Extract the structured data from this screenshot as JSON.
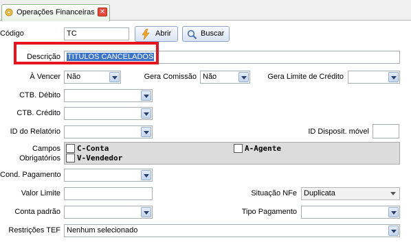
{
  "tab": {
    "label": "Operações Financeiras",
    "close_glyph": "✕",
    "icon": "gear-icon"
  },
  "toolbar": {
    "codigo_label": "Código",
    "codigo_value": "TC",
    "abrir_label": "Abrir",
    "buscar_label": "Buscar"
  },
  "form": {
    "descricao_label": "Descrição",
    "descricao_value": "TITULOS CANCELADOS",
    "a_vencer_label": "À Vencer",
    "a_vencer_value": "Não",
    "gera_comissao_label": "Gera Comissão",
    "gera_comissao_value": "Não",
    "gera_limite_label": "Gera Limite de Crédito",
    "gera_limite_value": "",
    "ctb_debito_label": "CTB. Débito",
    "ctb_credito_label": "CTB. Crédito",
    "id_relatorio_label": "ID do Relatório",
    "id_disposit_label": "ID Disposit. móvel",
    "campos_label_1": "Campos",
    "campos_label_2": "Obrigatórios",
    "checkboxes": {
      "c_conta": "C-Conta",
      "a_agente": "A-Agente",
      "v_vendedor": "V-Vendedor"
    },
    "cond_pagamento_label": "Cond. Pagamento",
    "valor_limite_label": "Valor Limite",
    "situacao_nfe_label": "Situação NFe",
    "situacao_nfe_value": "Duplicata",
    "conta_padrao_label": "Conta padrão",
    "tipo_pagamento_label": "Tipo Pagamento",
    "restricoes_tef_label": "Restrições TEF",
    "restricoes_tef_value": "Nenhum selecionado"
  },
  "colors": {
    "highlight": "#e6141e",
    "selection": "#3b74c8",
    "tab_close": "#e84a3a"
  }
}
